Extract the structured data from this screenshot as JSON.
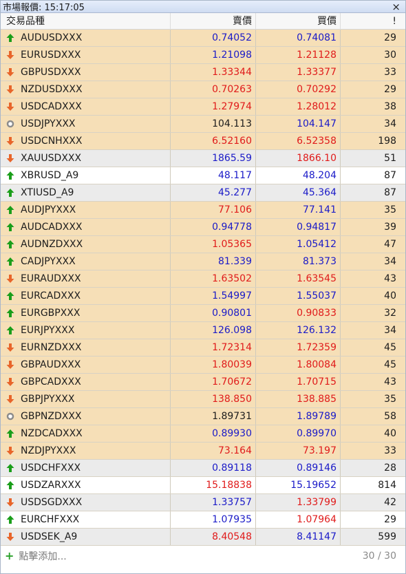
{
  "window": {
    "title": "市場報價: 15:17:05",
    "close_glyph": "×"
  },
  "columns": {
    "symbol": "交易品種",
    "bid": "賣價",
    "ask": "買價",
    "spread": "!"
  },
  "colors": {
    "up": "#1a9e1a",
    "down": "#e8652a",
    "neutral": "#8c8c8c",
    "blue": "#1a1ac8",
    "red": "#e01a1a"
  },
  "rows": [
    {
      "symbol": "AUDUSDXXX",
      "bid": "0.74052",
      "ask": "0.74081",
      "spread": "29",
      "dir": "up",
      "bg": "orange",
      "bid_color": "blue",
      "ask_color": "blue"
    },
    {
      "symbol": "EURUSDXXX",
      "bid": "1.21098",
      "ask": "1.21128",
      "spread": "30",
      "dir": "down",
      "bg": "orange",
      "bid_color": "blue",
      "ask_color": "red"
    },
    {
      "symbol": "GBPUSDXXX",
      "bid": "1.33344",
      "ask": "1.33377",
      "spread": "33",
      "dir": "down",
      "bg": "orange",
      "bid_color": "red",
      "ask_color": "red"
    },
    {
      "symbol": "NZDUSDXXX",
      "bid": "0.70263",
      "ask": "0.70292",
      "spread": "29",
      "dir": "down",
      "bg": "orange",
      "bid_color": "red",
      "ask_color": "red"
    },
    {
      "symbol": "USDCADXXX",
      "bid": "1.27974",
      "ask": "1.28012",
      "spread": "38",
      "dir": "down",
      "bg": "orange",
      "bid_color": "red",
      "ask_color": "red"
    },
    {
      "symbol": "USDJPYXXX",
      "bid": "104.113",
      "ask": "104.147",
      "spread": "34",
      "dir": "neutral",
      "bg": "orange",
      "bid_color": "black",
      "ask_color": "blue"
    },
    {
      "symbol": "USDCNHXXX",
      "bid": "6.52160",
      "ask": "6.52358",
      "spread": "198",
      "dir": "down",
      "bg": "orange",
      "bid_color": "red",
      "ask_color": "red"
    },
    {
      "symbol": "XAUUSDXXX",
      "bid": "1865.59",
      "ask": "1866.10",
      "spread": "51",
      "dir": "down",
      "bg": "gray",
      "bid_color": "blue",
      "ask_color": "red"
    },
    {
      "symbol": "XBRUSD_A9",
      "bid": "48.117",
      "ask": "48.204",
      "spread": "87",
      "dir": "up",
      "bg": "white",
      "bid_color": "blue",
      "ask_color": "blue"
    },
    {
      "symbol": "XTIUSD_A9",
      "bid": "45.277",
      "ask": "45.364",
      "spread": "87",
      "dir": "up",
      "bg": "gray",
      "bid_color": "blue",
      "ask_color": "blue"
    },
    {
      "symbol": "AUDJPYXXX",
      "bid": "77.106",
      "ask": "77.141",
      "spread": "35",
      "dir": "up",
      "bg": "orange",
      "bid_color": "red",
      "ask_color": "blue"
    },
    {
      "symbol": "AUDCADXXX",
      "bid": "0.94778",
      "ask": "0.94817",
      "spread": "39",
      "dir": "up",
      "bg": "orange",
      "bid_color": "blue",
      "ask_color": "blue"
    },
    {
      "symbol": "AUDNZDXXX",
      "bid": "1.05365",
      "ask": "1.05412",
      "spread": "47",
      "dir": "up",
      "bg": "orange",
      "bid_color": "red",
      "ask_color": "blue"
    },
    {
      "symbol": "CADJPYXXX",
      "bid": "81.339",
      "ask": "81.373",
      "spread": "34",
      "dir": "up",
      "bg": "orange",
      "bid_color": "blue",
      "ask_color": "blue"
    },
    {
      "symbol": "EURAUDXXX",
      "bid": "1.63502",
      "ask": "1.63545",
      "spread": "43",
      "dir": "down",
      "bg": "orange",
      "bid_color": "red",
      "ask_color": "red"
    },
    {
      "symbol": "EURCADXXX",
      "bid": "1.54997",
      "ask": "1.55037",
      "spread": "40",
      "dir": "up",
      "bg": "orange",
      "bid_color": "blue",
      "ask_color": "blue"
    },
    {
      "symbol": "EURGBPXXX",
      "bid": "0.90801",
      "ask": "0.90833",
      "spread": "32",
      "dir": "up",
      "bg": "orange",
      "bid_color": "blue",
      "ask_color": "red"
    },
    {
      "symbol": "EURJPYXXX",
      "bid": "126.098",
      "ask": "126.132",
      "spread": "34",
      "dir": "up",
      "bg": "orange",
      "bid_color": "blue",
      "ask_color": "blue"
    },
    {
      "symbol": "EURNZDXXX",
      "bid": "1.72314",
      "ask": "1.72359",
      "spread": "45",
      "dir": "down",
      "bg": "orange",
      "bid_color": "red",
      "ask_color": "red"
    },
    {
      "symbol": "GBPAUDXXX",
      "bid": "1.80039",
      "ask": "1.80084",
      "spread": "45",
      "dir": "down",
      "bg": "orange",
      "bid_color": "red",
      "ask_color": "red"
    },
    {
      "symbol": "GBPCADXXX",
      "bid": "1.70672",
      "ask": "1.70715",
      "spread": "43",
      "dir": "down",
      "bg": "orange",
      "bid_color": "red",
      "ask_color": "red"
    },
    {
      "symbol": "GBPJPYXXX",
      "bid": "138.850",
      "ask": "138.885",
      "spread": "35",
      "dir": "down",
      "bg": "orange",
      "bid_color": "red",
      "ask_color": "red"
    },
    {
      "symbol": "GBPNZDXXX",
      "bid": "1.89731",
      "ask": "1.89789",
      "spread": "58",
      "dir": "neutral",
      "bg": "orange",
      "bid_color": "black",
      "ask_color": "blue"
    },
    {
      "symbol": "NZDCADXXX",
      "bid": "0.89930",
      "ask": "0.89970",
      "spread": "40",
      "dir": "up",
      "bg": "orange",
      "bid_color": "blue",
      "ask_color": "blue"
    },
    {
      "symbol": "NZDJPYXXX",
      "bid": "73.164",
      "ask": "73.197",
      "spread": "33",
      "dir": "down",
      "bg": "orange",
      "bid_color": "red",
      "ask_color": "red"
    },
    {
      "symbol": "USDCHFXXX",
      "bid": "0.89118",
      "ask": "0.89146",
      "spread": "28",
      "dir": "up",
      "bg": "gray",
      "bid_color": "blue",
      "ask_color": "blue"
    },
    {
      "symbol": "USDZARXXX",
      "bid": "15.18838",
      "ask": "15.19652",
      "spread": "814",
      "dir": "up",
      "bg": "white",
      "bid_color": "red",
      "ask_color": "blue"
    },
    {
      "symbol": "USDSGDXXX",
      "bid": "1.33757",
      "ask": "1.33799",
      "spread": "42",
      "dir": "down",
      "bg": "gray",
      "bid_color": "blue",
      "ask_color": "red"
    },
    {
      "symbol": "EURCHFXXX",
      "bid": "1.07935",
      "ask": "1.07964",
      "spread": "29",
      "dir": "up",
      "bg": "white",
      "bid_color": "blue",
      "ask_color": "red"
    },
    {
      "symbol": "USDSEK_A9",
      "bid": "8.40548",
      "ask": "8.41147",
      "spread": "599",
      "dir": "down",
      "bg": "gray",
      "bid_color": "red",
      "ask_color": "blue"
    }
  ],
  "footer": {
    "add_label": "點擊添加...",
    "count": "30 / 30"
  }
}
